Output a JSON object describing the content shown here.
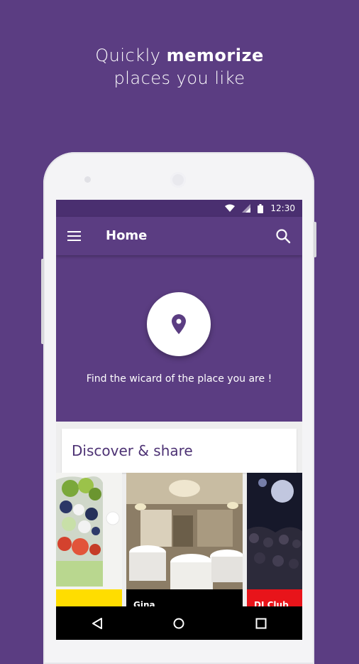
{
  "headline": {
    "line1_prefix": "Quickly",
    "line1_bold": "memorize",
    "line2": "places you like"
  },
  "status_bar": {
    "time": "12:30",
    "icons": [
      "wifi-icon",
      "signal-icon",
      "battery-icon"
    ]
  },
  "app_bar": {
    "title": "Home",
    "left_icon": "menu-icon",
    "right_icon": "search-icon"
  },
  "hero": {
    "icon": "location-pin-icon",
    "text": "Find the wicard of the place you are !"
  },
  "discover": {
    "title": "Discover & share"
  },
  "carousel": [
    {
      "name": "salad",
      "caption": "",
      "accent": "#ffdd00"
    },
    {
      "name": "restaurant",
      "caption": "Gina",
      "accent": "#000000"
    },
    {
      "name": "club",
      "caption": "DJ Club",
      "accent": "#e8141a"
    }
  ],
  "navigation": [
    "back-icon",
    "home-icon",
    "recents-icon"
  ],
  "colors": {
    "brand_purple": "#5b3d82",
    "status_purple": "#4a2f70",
    "title_purple": "#4d3274"
  }
}
